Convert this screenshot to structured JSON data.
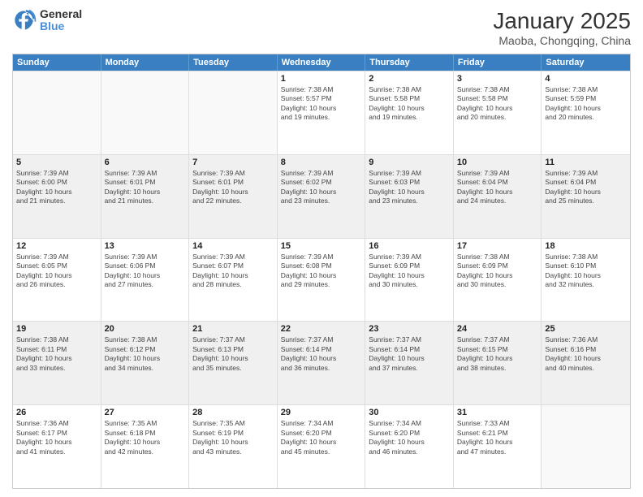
{
  "logo": {
    "general": "General",
    "blue": "Blue"
  },
  "title": "January 2025",
  "subtitle": "Maoba, Chongqing, China",
  "header_days": [
    "Sunday",
    "Monday",
    "Tuesday",
    "Wednesday",
    "Thursday",
    "Friday",
    "Saturday"
  ],
  "weeks": [
    [
      {
        "day": "",
        "info": ""
      },
      {
        "day": "",
        "info": ""
      },
      {
        "day": "",
        "info": ""
      },
      {
        "day": "1",
        "info": "Sunrise: 7:38 AM\nSunset: 5:57 PM\nDaylight: 10 hours\nand 19 minutes."
      },
      {
        "day": "2",
        "info": "Sunrise: 7:38 AM\nSunset: 5:58 PM\nDaylight: 10 hours\nand 19 minutes."
      },
      {
        "day": "3",
        "info": "Sunrise: 7:38 AM\nSunset: 5:58 PM\nDaylight: 10 hours\nand 20 minutes."
      },
      {
        "day": "4",
        "info": "Sunrise: 7:38 AM\nSunset: 5:59 PM\nDaylight: 10 hours\nand 20 minutes."
      }
    ],
    [
      {
        "day": "5",
        "info": "Sunrise: 7:39 AM\nSunset: 6:00 PM\nDaylight: 10 hours\nand 21 minutes."
      },
      {
        "day": "6",
        "info": "Sunrise: 7:39 AM\nSunset: 6:01 PM\nDaylight: 10 hours\nand 21 minutes."
      },
      {
        "day": "7",
        "info": "Sunrise: 7:39 AM\nSunset: 6:01 PM\nDaylight: 10 hours\nand 22 minutes."
      },
      {
        "day": "8",
        "info": "Sunrise: 7:39 AM\nSunset: 6:02 PM\nDaylight: 10 hours\nand 23 minutes."
      },
      {
        "day": "9",
        "info": "Sunrise: 7:39 AM\nSunset: 6:03 PM\nDaylight: 10 hours\nand 23 minutes."
      },
      {
        "day": "10",
        "info": "Sunrise: 7:39 AM\nSunset: 6:04 PM\nDaylight: 10 hours\nand 24 minutes."
      },
      {
        "day": "11",
        "info": "Sunrise: 7:39 AM\nSunset: 6:04 PM\nDaylight: 10 hours\nand 25 minutes."
      }
    ],
    [
      {
        "day": "12",
        "info": "Sunrise: 7:39 AM\nSunset: 6:05 PM\nDaylight: 10 hours\nand 26 minutes."
      },
      {
        "day": "13",
        "info": "Sunrise: 7:39 AM\nSunset: 6:06 PM\nDaylight: 10 hours\nand 27 minutes."
      },
      {
        "day": "14",
        "info": "Sunrise: 7:39 AM\nSunset: 6:07 PM\nDaylight: 10 hours\nand 28 minutes."
      },
      {
        "day": "15",
        "info": "Sunrise: 7:39 AM\nSunset: 6:08 PM\nDaylight: 10 hours\nand 29 minutes."
      },
      {
        "day": "16",
        "info": "Sunrise: 7:39 AM\nSunset: 6:09 PM\nDaylight: 10 hours\nand 30 minutes."
      },
      {
        "day": "17",
        "info": "Sunrise: 7:38 AM\nSunset: 6:09 PM\nDaylight: 10 hours\nand 30 minutes."
      },
      {
        "day": "18",
        "info": "Sunrise: 7:38 AM\nSunset: 6:10 PM\nDaylight: 10 hours\nand 32 minutes."
      }
    ],
    [
      {
        "day": "19",
        "info": "Sunrise: 7:38 AM\nSunset: 6:11 PM\nDaylight: 10 hours\nand 33 minutes."
      },
      {
        "day": "20",
        "info": "Sunrise: 7:38 AM\nSunset: 6:12 PM\nDaylight: 10 hours\nand 34 minutes."
      },
      {
        "day": "21",
        "info": "Sunrise: 7:37 AM\nSunset: 6:13 PM\nDaylight: 10 hours\nand 35 minutes."
      },
      {
        "day": "22",
        "info": "Sunrise: 7:37 AM\nSunset: 6:14 PM\nDaylight: 10 hours\nand 36 minutes."
      },
      {
        "day": "23",
        "info": "Sunrise: 7:37 AM\nSunset: 6:14 PM\nDaylight: 10 hours\nand 37 minutes."
      },
      {
        "day": "24",
        "info": "Sunrise: 7:37 AM\nSunset: 6:15 PM\nDaylight: 10 hours\nand 38 minutes."
      },
      {
        "day": "25",
        "info": "Sunrise: 7:36 AM\nSunset: 6:16 PM\nDaylight: 10 hours\nand 40 minutes."
      }
    ],
    [
      {
        "day": "26",
        "info": "Sunrise: 7:36 AM\nSunset: 6:17 PM\nDaylight: 10 hours\nand 41 minutes."
      },
      {
        "day": "27",
        "info": "Sunrise: 7:35 AM\nSunset: 6:18 PM\nDaylight: 10 hours\nand 42 minutes."
      },
      {
        "day": "28",
        "info": "Sunrise: 7:35 AM\nSunset: 6:19 PM\nDaylight: 10 hours\nand 43 minutes."
      },
      {
        "day": "29",
        "info": "Sunrise: 7:34 AM\nSunset: 6:20 PM\nDaylight: 10 hours\nand 45 minutes."
      },
      {
        "day": "30",
        "info": "Sunrise: 7:34 AM\nSunset: 6:20 PM\nDaylight: 10 hours\nand 46 minutes."
      },
      {
        "day": "31",
        "info": "Sunrise: 7:33 AM\nSunset: 6:21 PM\nDaylight: 10 hours\nand 47 minutes."
      },
      {
        "day": "",
        "info": ""
      }
    ]
  ]
}
